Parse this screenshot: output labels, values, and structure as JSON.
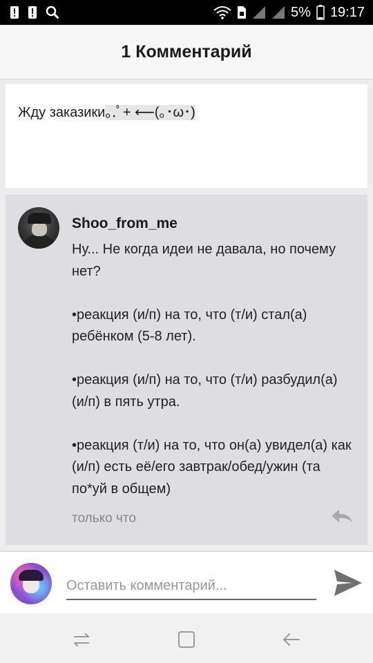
{
  "status_bar": {
    "battery_percent": "5%",
    "time": "19:17",
    "icons": [
      "alert-icon",
      "alert-icon",
      "search-icon",
      "wifi-icon",
      "sim-icon",
      "signal-icon",
      "signal-icon",
      "battery-icon"
    ]
  },
  "header": {
    "title": "1 Комментарий"
  },
  "post": {
    "text": "Жду заказики",
    "kaomoji": "｡.ﾟ+ ⟵(｡･ω･)"
  },
  "comment": {
    "author": "Shoo_from_me",
    "paragraphs": [
      "Ну... Не когда идеи не давала, но почему нет?",
      "•реакция (и/п) на то, что (т/и) стал(а) ребёнком (5-8 лет).",
      "•реакция (и/п) на то, что (т/и) разбудил(а) (и/п) в пять утра.",
      "•реакция (т/и) на то, что он(а) увидел(а) как (и/п) есть её/его завтрак/обед/ужин (та по*уй в общем)"
    ],
    "time": "только что",
    "reply_icon": "reply-icon"
  },
  "composer": {
    "placeholder": "Оставить комментарий...",
    "value": "",
    "send_icon": "send-icon"
  },
  "nav": {
    "items": [
      "recent-apps-icon",
      "home-icon",
      "back-icon"
    ]
  },
  "colors": {
    "status_bar": "#000000",
    "comment_bg": "#dedde2",
    "app_bg": "#ededed"
  }
}
